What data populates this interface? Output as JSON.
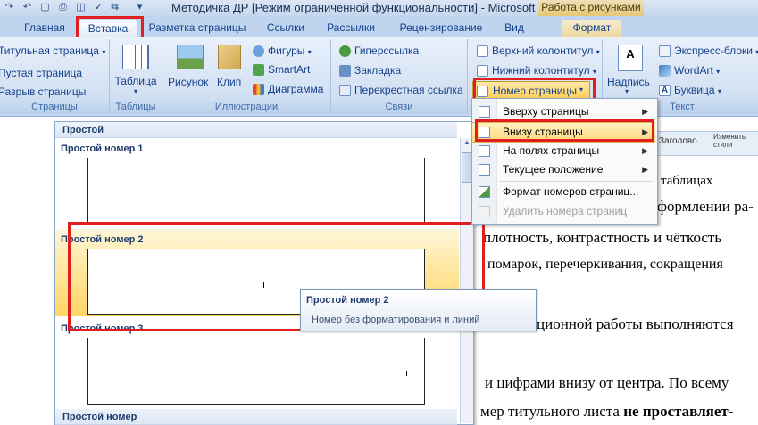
{
  "titlebar": {
    "title": "Методичка ДР [Режим ограниченной функциональности] - Microsoft W",
    "contextual_tab": "Работа с рисунками",
    "qat_icons": [
      "app-menu-icon",
      "redo-icon",
      "undo-icon",
      "print-icon",
      "qat-dropdown-icon"
    ]
  },
  "tabs": [
    "Главная",
    "Вставка",
    "Разметка страницы",
    "Ссылки",
    "Рассылки",
    "Рецензирование",
    "Вид",
    "Формат"
  ],
  "active_tab": "Вставка",
  "ribbon": {
    "pages": {
      "label": "Страницы",
      "items": [
        "Титульная страница",
        "Пустая страница",
        "Разрыв страницы"
      ]
    },
    "tables": {
      "label": "Таблицы",
      "button": "Таблица"
    },
    "illustrations": {
      "label": "Иллюстрации",
      "picture": "Рисунок",
      "clip": "Клип",
      "shapes": "Фигуры",
      "smartart": "SmartArt",
      "chart": "Диаграмма"
    },
    "links": {
      "label": "Связи",
      "hyperlink": "Гиперссылка",
      "bookmark": "Закладка",
      "crossref": "Перекрестная ссылка"
    },
    "headers": {
      "header": "Верхний колонтитул",
      "footer": "Нижний колонтитул",
      "page_number": "Номер страницы"
    },
    "text": {
      "label": "Текст",
      "textbox": "Надпись",
      "quickparts": "Экспресс-блоки",
      "wordart": "WordArt",
      "dropcap": "Буквица"
    },
    "styles_fragment": {
      "style1": "Заголово...",
      "style2": "Изменить стили"
    }
  },
  "document": {
    "lines": [
      "таблицах",
      "формлении ра-",
      "плотность, контрастность и чёткость",
      "помарок, перечеркивания, сокращения",
      "ционной работы выполняются",
      "и цифрами внизу от центра. По всему",
      "мер титульного листа"
    ],
    "bold_tail": "не проставляет-"
  },
  "gallery": {
    "section1": "Простой",
    "items": [
      "Простой номер 1",
      "Простой номер 2",
      "Простой номер 3"
    ],
    "section2": "Простой номер"
  },
  "menu": {
    "items": [
      {
        "label": "Вверху страницы",
        "icon": "page-top-icon",
        "submenu": true
      },
      {
        "label": "Внизу страницы",
        "icon": "page-bottom-icon",
        "submenu": true
      },
      {
        "label": "На полях страницы",
        "icon": "page-margins-icon",
        "submenu": true
      },
      {
        "label": "Текущее положение",
        "icon": "current-position-icon",
        "submenu": true
      },
      {
        "label": "Формат номеров страниц...",
        "icon": "format-numbers-icon",
        "submenu": false
      },
      {
        "label": "Удалить номера страниц",
        "icon": "remove-numbers-icon",
        "submenu": false
      }
    ]
  },
  "tooltip": {
    "title": "Простой номер 2",
    "description": "Номер без форматирования и линий"
  },
  "colors": {
    "highlight": "#e02020",
    "menu_hover": "#ffd77a",
    "ribbon_bg": "#d3e1f3"
  }
}
